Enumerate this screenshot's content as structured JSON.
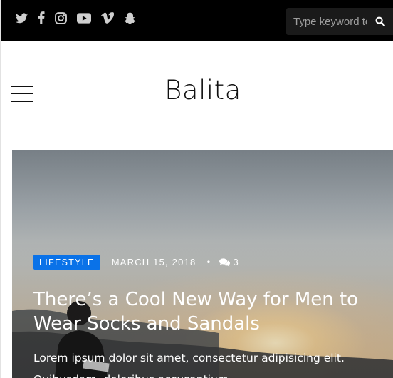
{
  "topbar": {
    "social_icons": [
      "twitter-icon",
      "facebook-icon",
      "instagram-icon",
      "youtube-icon",
      "vimeo-icon",
      "snapchat-icon"
    ],
    "search": {
      "placeholder": "Type keyword to search",
      "button_icon": "search-icon"
    }
  },
  "header": {
    "menu_icon": "hamburger-menu-icon",
    "site_title": "Balita"
  },
  "featured_post": {
    "category": "LIFESTYLE",
    "date": "MARCH 15, 2018",
    "separator": "•",
    "comment_count": "3",
    "title": "There’s a Cool New Way for Men to Wear Socks and Sandals",
    "excerpt": "Lorem ipsum dolor sit amet, consectetur adipisicing elit. Quibusdam, doloribus accusantium"
  },
  "colors": {
    "topbar_bg": "#000000",
    "badge_bg": "#0a72e8",
    "title_text": "#111111"
  }
}
